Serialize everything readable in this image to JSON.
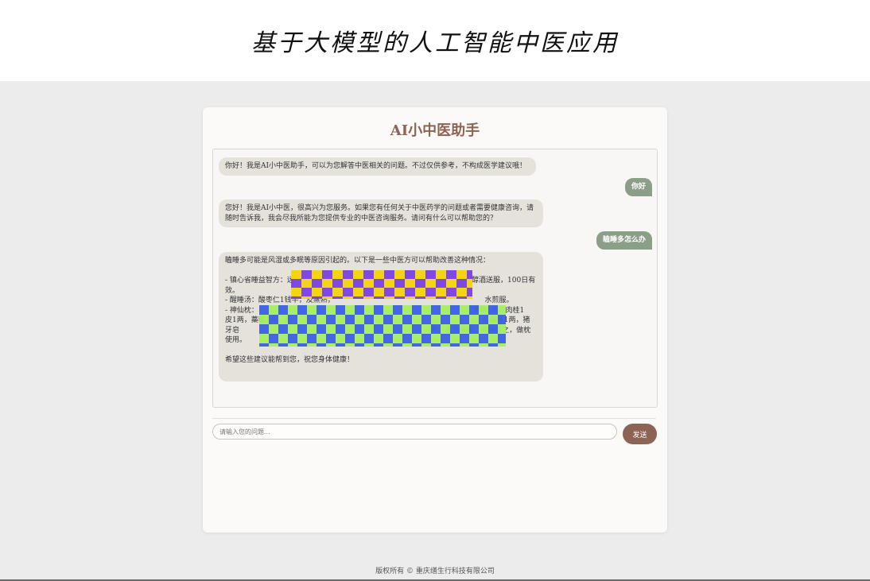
{
  "header": {
    "title": "基于大模型的人工智能中医应用"
  },
  "assistant": {
    "title": "AI小中医助手"
  },
  "messages": [
    {
      "role": "bot",
      "text": "你好！我是AI小中医助手，可以为您解答中医相关的问题。不过仅供参考，不构成医学建议哦！"
    },
    {
      "role": "user",
      "text": "你好"
    },
    {
      "role": "bot",
      "text": "您好！我是AI小中医，很高兴为您服务。如果您有任何关于中医药学的问题或者需要健康咨询，请随时告诉我，我会尽我所能为您提供专业的中医咨询服务。请问有什么可以帮助您的？"
    },
    {
      "role": "user",
      "text": "瞌睡多怎么办"
    },
    {
      "role": "bot",
      "text": "瞌睡多可能是风湿或多眠等原因引起的。以下是一些中医方可以帮助改善这种情况：\n\n- 镇心省睡益智方：远                                                                              醇酒送服，100日有效。\n- 醒睡汤：酸枣仁1钱半，及蒸熟，                                                                  水煎服。\n- 神仙枕：                                                                                              薄荷1两，肉桂1                                                                                      皮1两，藁藜1两，羌                                                                                    北细辛1两，猪牙皂                                                                                    两。上为细末，绢袋盛之，做枕使用。\n\n希望这些建议能帮到您，祝您身体健康！"
    }
  ],
  "input": {
    "placeholder": "请输入您的问题...",
    "value": ""
  },
  "send_button": {
    "label": "发送"
  },
  "footer": {
    "copyright": "版权所有 © 重庆缮生行科技有限公司"
  },
  "colors": {
    "accent": "#8d6454",
    "user_bubble": "#8a9e88",
    "bot_bubble": "#e5e2dc",
    "page_bg": "#ececec"
  }
}
